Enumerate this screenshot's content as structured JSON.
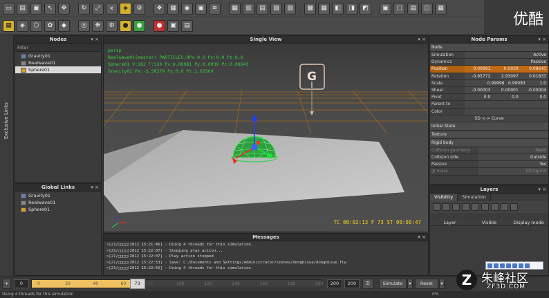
{
  "watermark_top": "优酷",
  "toolbar_row1": [
    "▭",
    "▤",
    "▣",
    "↖",
    "✥",
    "↻",
    "⤢",
    "⚹",
    "◈",
    "⚙",
    "❖",
    "▦",
    "◉",
    "▣",
    "≋",
    "▦",
    "▥",
    "▤",
    "▧",
    "▨",
    "▩",
    "▦",
    "◧",
    "◨",
    "◩",
    "▣",
    "▢",
    "▤",
    "◫",
    "▦"
  ],
  "toolbar_row2": [
    "▦",
    "◈",
    "⬡",
    "✿",
    "◆",
    "◎",
    "❋",
    "⚙",
    "●",
    "●",
    "●",
    "▣",
    "▤"
  ],
  "nodes": {
    "title": "Nodes",
    "filter": "Filter",
    "items": [
      "Gravity01",
      "Realwave01",
      "Sphere01"
    ]
  },
  "left_strip": {
    "label": "Exclusive Links"
  },
  "global_links": {
    "title": "Global Links",
    "items": [
      "Gravity01",
      "Realwave01",
      "Sphere01"
    ]
  },
  "view": {
    "title": "Single View",
    "hud": [
      "persp",
      "Realwave01(master) PARTICLES:0Px:0.0 Py:0.0 Pz:0.0",
      "Sphere01 V:162 F:320 Px:0.00981 Py:0.0039 Pz:0.08643",
      "Gravity01 Px:-3.50279 Py:0.0 Pz:1.62569"
    ],
    "gizmo_label": "G",
    "timecode": "TC 00:02:13   F 73   ST 00:00:47"
  },
  "messages": {
    "title": "Messages",
    "lines": [
      ">[21/□□□□/2012 15:21:46] - Using 4 threads for this simulation.",
      ">[21/□□□□/2012 15:22:07] - Stopping play action...",
      ">[21/□□□□/2012 15:22:07] - Play action stopped",
      ">[21/□□□□/2012 15:22:53] - Save: C:/Documents and Settings/Administrator/scenes/dongbixue/dongbixue.flw",
      ">[21/□□□□/2012 15:22:56] - Using 4 threads for this simulation."
    ]
  },
  "params": {
    "title": "Node Params",
    "node_label": "Node",
    "rows": [
      {
        "k": "Simulation",
        "v": [
          "",
          "",
          "Active"
        ]
      },
      {
        "k": "Dynamics",
        "v": [
          "",
          "",
          "Passive rigid body"
        ]
      },
      {
        "k": "Position",
        "v": [
          "0.00981",
          "0.0039",
          "0.08643"
        ],
        "hl": true
      },
      {
        "k": "Rotation",
        "v": [
          "-0.95772",
          "2.93097",
          "0.01837"
        ]
      },
      {
        "k": "Scale",
        "v": [
          "",
          "0.99998",
          "0.99993",
          "1.0"
        ]
      },
      {
        "k": "Shear",
        "v": [
          "-0.00003",
          "0.00001",
          "-0.00004"
        ]
      },
      {
        "k": "Pivot",
        "v": [
          "0.0",
          "0.0",
          "0.0"
        ]
      },
      {
        "k": "Parent to",
        "v": [
          "",
          "",
          ""
        ]
      },
      {
        "k": "Color",
        "v": [
          "",
          "",
          ""
        ]
      }
    ],
    "curve_label": "SD <-> Curve",
    "sections": [
      "Initial State",
      "Texture",
      "Rigid body"
    ],
    "rb_rows": [
      {
        "k": "Collision geometry",
        "v": "Mesh",
        "dim": true
      },
      {
        "k": "Collision side",
        "v": "Outside"
      },
      {
        "k": "Passive",
        "v": "Yes"
      },
      {
        "k": "@ mass",
        "v": "(0) kg/m3",
        "dim": true
      }
    ]
  },
  "layers": {
    "title": "Layers",
    "tabs": [
      "Visibility",
      "Simulation"
    ],
    "columns": [
      "Layer",
      "Visible",
      "Display mode"
    ]
  },
  "timeline": {
    "start": "0",
    "ticks": [
      "0",
      "20",
      "40",
      "60",
      "80",
      "100",
      "120",
      "140",
      "160",
      "180",
      "200"
    ],
    "current": "73",
    "current_fraction": 0.365,
    "end_a": "200",
    "end_b": "200",
    "simulate": "Simulate",
    "reset": "Reset"
  },
  "status": {
    "text": "Using 4 threads for this simulation",
    "pct": "0%"
  },
  "site_watermark": {
    "cn": "朱峰社区",
    "en": "ZF3D.COM"
  }
}
